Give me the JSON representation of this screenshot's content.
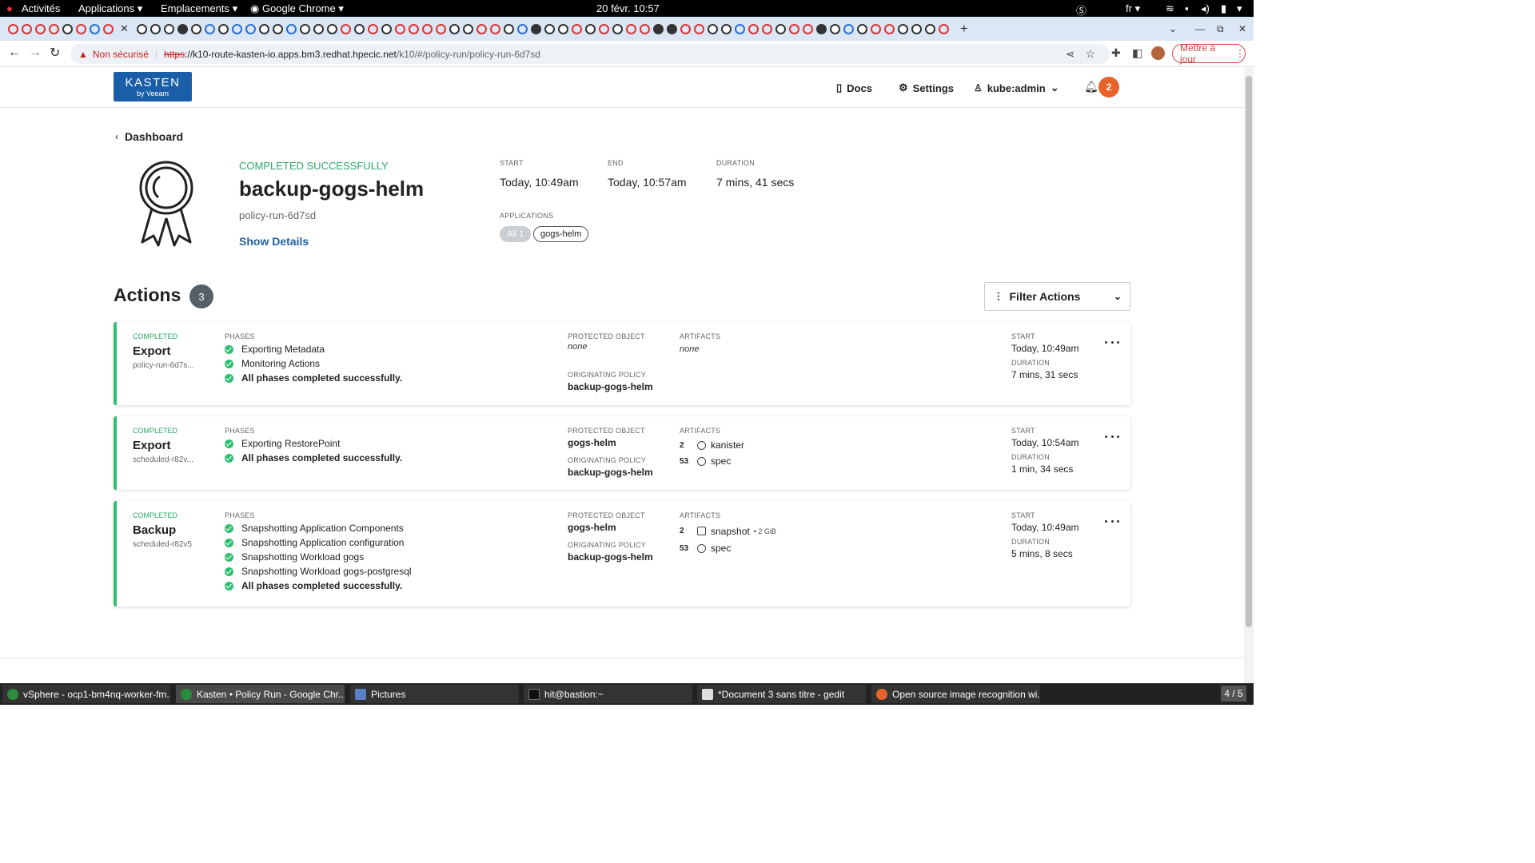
{
  "system": {
    "activities": "Activités",
    "applications": "Applications",
    "places": "Emplacements",
    "browser_app": "Google Chrome",
    "clock": "20 févr.  10:57",
    "lang": "fr"
  },
  "browser": {
    "not_secure": "Non sécurisé",
    "url_scheme": "https",
    "url_host": "://k10-route-kasten-io.apps.bm3.redhat.hpecic.net",
    "url_path": "/k10/#/policy-run/policy-run-6d7sd",
    "update_button": "Mettre à jour"
  },
  "header": {
    "logo_main": "KASTEN",
    "logo_sub": "by Veeam",
    "docs": "Docs",
    "settings": "Settings",
    "user": "kube:admin",
    "notification_count": "2"
  },
  "breadcrumb": {
    "back": "Dashboard"
  },
  "run": {
    "status": "COMPLETED SUCCESSFULLY",
    "name": "backup-gogs-helm",
    "id": "policy-run-6d7sd",
    "show_details": "Show Details",
    "start_label": "START",
    "start": "Today, 10:49am",
    "end_label": "END",
    "end": "Today, 10:57am",
    "duration_label": "DURATION",
    "duration": "7 mins, 41 secs",
    "applications_label": "APPLICATIONS",
    "app_all": "All 1",
    "app_name": "gogs-helm"
  },
  "actions": {
    "title": "Actions",
    "count": "3",
    "filter": "Filter Actions",
    "labels": {
      "phases": "PHASES",
      "protected": "PROTECTED OBJECT",
      "originating": "ORIGINATING POLICY",
      "artifacts": "ARTIFACTS",
      "start": "START",
      "duration": "DURATION"
    },
    "items": [
      {
        "status": "COMPLETED",
        "type": "Export",
        "id": "policy-run-6d7s...",
        "phases": [
          "Exporting Metadata",
          "Monitoring Actions"
        ],
        "final": "All phases completed successfully.",
        "protected": "none",
        "policy": "backup-gogs-helm",
        "artifacts_none": "none",
        "start": "Today, 10:49am",
        "duration": "7 mins, 31 secs"
      },
      {
        "status": "COMPLETED",
        "type": "Export",
        "id": "scheduled-r82v...",
        "phases": [
          "Exporting RestorePoint"
        ],
        "final": "All phases completed successfully.",
        "protected": "gogs-helm",
        "policy": "backup-gogs-helm",
        "artifacts": [
          {
            "count": "2",
            "name": "kanister",
            "extra": ""
          },
          {
            "count": "53",
            "name": "spec",
            "extra": ""
          }
        ],
        "start": "Today, 10:54am",
        "duration": "1 min, 34 secs"
      },
      {
        "status": "COMPLETED",
        "type": "Backup",
        "id": "scheduled-r82v5",
        "phases": [
          "Snapshotting Application Components",
          "Snapshotting Application configuration",
          "Snapshotting Workload gogs",
          "Snapshotting Workload gogs-postgresql"
        ],
        "final": "All phases completed successfully.",
        "protected": "gogs-helm",
        "policy": "backup-gogs-helm",
        "artifacts": [
          {
            "count": "2",
            "name": "snapshot",
            "extra": "• 2 GiB"
          },
          {
            "count": "53",
            "name": "spec",
            "extra": ""
          }
        ],
        "start": "Today, 10:49am",
        "duration": "5 mins, 8 secs"
      }
    ]
  },
  "taskbar": {
    "items": [
      "vSphere - ocp1-bm4nq-worker-fm...",
      "Kasten • Policy Run - Google Chr...",
      "Pictures",
      "hit@bastion:~",
      "*Document 3 sans titre - gedit",
      "Open source image recognition wi..."
    ],
    "workspace": "4 / 5"
  },
  "colors": {
    "accent_green": "#2fbf71",
    "brand_blue": "#1b5ea8",
    "badge_orange": "#e8632b",
    "link_blue": "#1f5fa6"
  }
}
